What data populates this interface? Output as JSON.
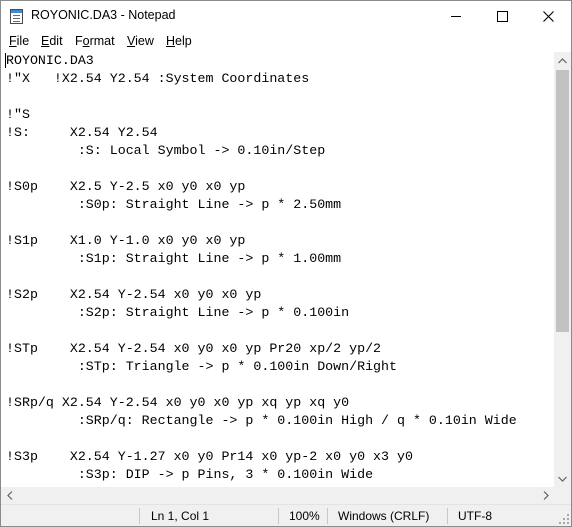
{
  "window": {
    "title": "ROYONIC.DA3 - Notepad"
  },
  "titlebar": {
    "app_icon": "notepad-icon",
    "minimize_icon": "minimize-icon",
    "maximize_icon": "maximize-icon",
    "close_icon": "close-icon"
  },
  "menu": {
    "items": [
      {
        "underline": "F",
        "rest": "ile"
      },
      {
        "underline": "E",
        "rest": "dit"
      },
      {
        "underline": "F",
        "pre": "",
        "rest": "ormat",
        "u_pos": "o"
      },
      {
        "underline": "V",
        "rest": "iew"
      },
      {
        "underline": "H",
        "rest": "elp"
      }
    ]
  },
  "editor": {
    "lines": [
      "ROYONIC.DA3",
      "!\"X   !X2.54 Y2.54 :System Coordinates",
      "",
      "!\"S",
      "!S:     X2.54 Y2.54",
      "         :S: Local Symbol -> 0.10in/Step",
      "",
      "!S0p    X2.5 Y-2.5 x0 y0 x0 yp",
      "         :S0p: Straight Line -> p * 2.50mm",
      "",
      "!S1p    X1.0 Y-1.0 x0 y0 x0 yp",
      "         :S1p: Straight Line -> p * 1.00mm",
      "",
      "!S2p    X2.54 Y-2.54 x0 y0 x0 yp",
      "         :S2p: Straight Line -> p * 0.100in",
      "",
      "!STp    X2.54 Y-2.54 x0 y0 x0 yp Pr20 xp/2 yp/2",
      "         :STp: Triangle -> p * 0.100in Down/Right",
      "",
      "!SRp/q X2.54 Y-2.54 x0 y0 x0 yp xq yp xq y0",
      "         :SRp/q: Rectangle -> p * 0.100in High / q * 0.10in Wide",
      "",
      "!S3p    X2.54 Y-1.27 x0 y0 Pr14 x0 yp-2 x0 y0 x3 y0",
      "         :S3p: DIP -> p Pins, 3 * 0.100in Wide",
      ""
    ]
  },
  "statusbar": {
    "position": "Ln 1, Col 1",
    "zoom": "100%",
    "line_endings": "Windows (CRLF)",
    "encoding": "UTF-8"
  }
}
